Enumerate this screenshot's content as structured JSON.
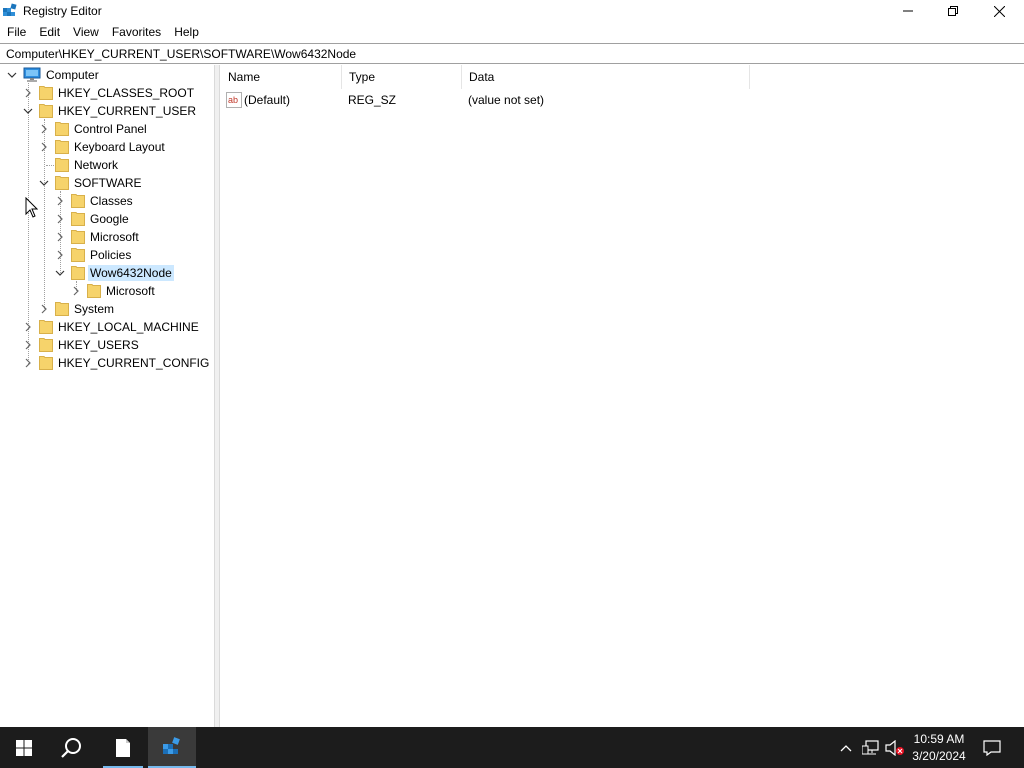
{
  "window": {
    "title": "Registry Editor",
    "minimize_icon": "minimize-icon",
    "maximize_icon": "restore-icon",
    "close_icon": "close-icon"
  },
  "menu": [
    "File",
    "Edit",
    "View",
    "Favorites",
    "Help"
  ],
  "address": {
    "value": "Computer\\HKEY_CURRENT_USER\\SOFTWARE\\Wow6432Node"
  },
  "tree": {
    "root": "Computer",
    "hkcr": "HKEY_CLASSES_ROOT",
    "hkcu": "HKEY_CURRENT_USER",
    "control_panel": "Control Panel",
    "keyboard_layout": "Keyboard Layout",
    "network": "Network",
    "software": "SOFTWARE",
    "classes": "Classes",
    "google": "Google",
    "microsoft": "Microsoft",
    "policies": "Policies",
    "wow6432node": "Wow6432Node",
    "wow_microsoft": "Microsoft",
    "system": "System",
    "hklm": "HKEY_LOCAL_MACHINE",
    "hku": "HKEY_USERS",
    "hkcc": "HKEY_CURRENT_CONFIG"
  },
  "list": {
    "columns": [
      "Name",
      "Type",
      "Data"
    ],
    "rows": [
      {
        "name": "(Default)",
        "type": "REG_SZ",
        "data": "(value not set)"
      }
    ]
  },
  "taskbar": {
    "time": "10:59 AM",
    "date": "3/20/2024"
  },
  "colors": {
    "selection": "#cce8ff",
    "folder": "#f6d36b",
    "taskbar": "#1c1c1c",
    "accent": "#76b9ed"
  }
}
